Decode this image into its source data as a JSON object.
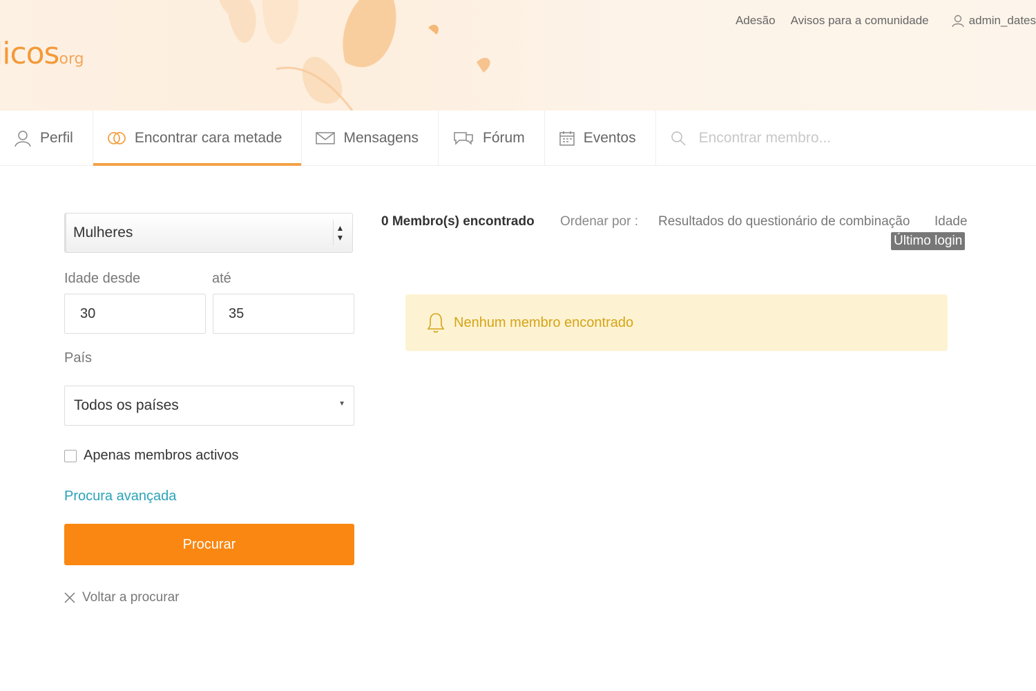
{
  "brand": {
    "logo_text": "licos",
    "logo_suffix": "org"
  },
  "top_links": {
    "join": "Adesão",
    "notices": "Avisos para a comunidade",
    "username": "admin_dates"
  },
  "nav": {
    "profile": "Perfil",
    "find_match": "Encontrar cara metade",
    "messages": "Mensagens",
    "forum": "Fórum",
    "events": "Eventos",
    "search_placeholder": "Encontrar membro..."
  },
  "filters": {
    "gender_selected": "Mulheres",
    "age_from_label": "Idade desde",
    "age_to_label": "até",
    "age_from": "30",
    "age_to": "35",
    "country_label": "País",
    "country_selected": "Todos os países",
    "active_only_label": "Apenas membros activos",
    "active_only_checked": false,
    "advanced_link": "Procura avançada",
    "search_button": "Procurar",
    "reset_link": "Voltar a procurar"
  },
  "results": {
    "count_text": "0 Membro(s) encontrado",
    "sort_label": "Ordenar por :",
    "sort_options": [
      "Resultados do questionário de combinação",
      "Idade",
      "Último login"
    ],
    "active_sort": "Último login",
    "empty_message": "Nenhum membro encontrado"
  },
  "colors": {
    "accent": "#fa8711",
    "nav_underline": "#f3a145",
    "link": "#2aa3b8",
    "alert_bg": "#fdf3d2",
    "alert_text": "#d6a317"
  }
}
